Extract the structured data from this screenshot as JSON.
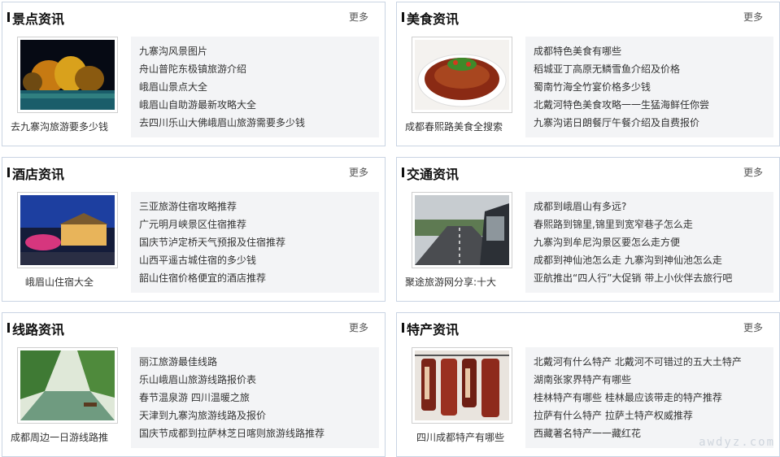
{
  "panels": [
    {
      "title": "景点资讯",
      "more": "更多",
      "caption": "去九寨沟旅游要多少钱",
      "items": [
        "九寨沟风景图片",
        "舟山普陀东极镇旅游介绍",
        "峨眉山景点大全",
        "峨眉山自助游最新攻略大全",
        "去四川乐山大佛峨眉山旅游需要多少钱"
      ]
    },
    {
      "title": "美食资讯",
      "more": "更多",
      "caption": "成都春熙路美食全搜索",
      "items": [
        "成都特色美食有哪些",
        "稻城亚丁高原无鳞雪鱼介绍及价格",
        "蜀南竹海全竹宴价格多少钱",
        "北戴河特色美食攻略一一生猛海鲜任你尝",
        "九寨沟诺日朗餐厅午餐介绍及自费报价"
      ]
    },
    {
      "title": "酒店资讯",
      "more": "更多",
      "caption": "峨眉山住宿大全",
      "items": [
        "三亚旅游住宿攻略推荐",
        "广元明月峡景区住宿推荐",
        "国庆节泸定桥天气预报及住宿推荐",
        "山西平遥古城住宿的多少钱",
        "韶山住宿价格便宜的酒店推荐"
      ]
    },
    {
      "title": "交通资讯",
      "more": "更多",
      "caption": "聚途旅游网分享:十大",
      "items": [
        "成都到峨眉山有多远?",
        "春熙路到锦里,锦里到宽窄巷子怎么走",
        "九寨沟到牟尼沟景区要怎么走方便",
        "成都到神仙池怎么走 九寨沟到神仙池怎么走",
        "亚航推出“四人行”大促销 带上小伙伴去旅行吧"
      ]
    },
    {
      "title": "线路资讯",
      "more": "更多",
      "caption": "成都周边一日游线路推",
      "items": [
        "丽江旅游最佳线路",
        "乐山峨眉山旅游线路报价表",
        "春节温泉游 四川温暖之旅",
        "天津到九寨沟旅游线路及报价",
        "国庆节成都到拉萨林芝日喀则旅游线路推荐"
      ]
    },
    {
      "title": "特产资讯",
      "more": "更多",
      "caption": "四川成都特产有哪些",
      "items": [
        "北戴河有什么特产 北戴河不可错过的五大土特产",
        "湖南张家界特产有哪些",
        "桂林特产有哪些 桂林最应该带走的特产推荐",
        "拉萨有什么特产 拉萨土特产权威推荐",
        "西藏著名特产一一藏红花"
      ]
    }
  ],
  "watermark": "awdyz.com"
}
